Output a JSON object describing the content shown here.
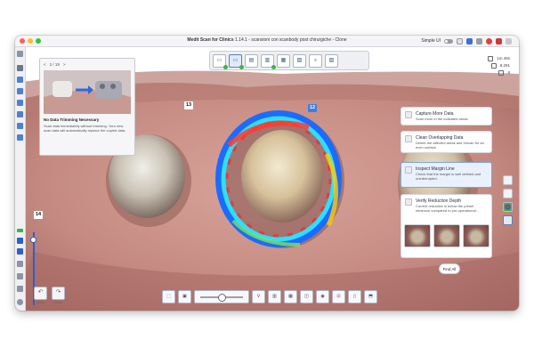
{
  "window": {
    "title_app": "Medit Scan for Clinics",
    "title_rest": "1.14.1 - scansioni con scanbody post chirurgiche - Clone",
    "mode_label": "Simple UI"
  },
  "status": {
    "time": "1m 48s",
    "count": "8,291",
    "third": "8"
  },
  "hint": {
    "page": "2 / 19",
    "prev": "<",
    "next": ">",
    "title": "No Data Trimming Necessary",
    "description": "Scan data immediately without trimming. Your new scan data will automatically replace the copied data."
  },
  "labels": {
    "tooth_13": "13",
    "tooth_12": "12",
    "tooth_14": "14"
  },
  "cards": [
    {
      "title": "Capture More Data",
      "desc": "Scan more in the indicated areas."
    },
    {
      "title": "Clean Overlapping Data",
      "desc": "Delete the affected areas and rescan for an even surface."
    },
    {
      "title": "Inspect Margin Line",
      "desc": "Check that the margin is well defined and uninterrupted."
    },
    {
      "title": "Verify Reduction Depth",
      "desc": "Current reduction is below the preset minimum compared to pre-operational..."
    }
  ],
  "find_all": "Find All",
  "undo_label": "Undo",
  "redo_label": "Redo",
  "colors": {
    "accent": "#2c5fd3",
    "success": "#3cb44a",
    "gum": "#c98f86"
  }
}
